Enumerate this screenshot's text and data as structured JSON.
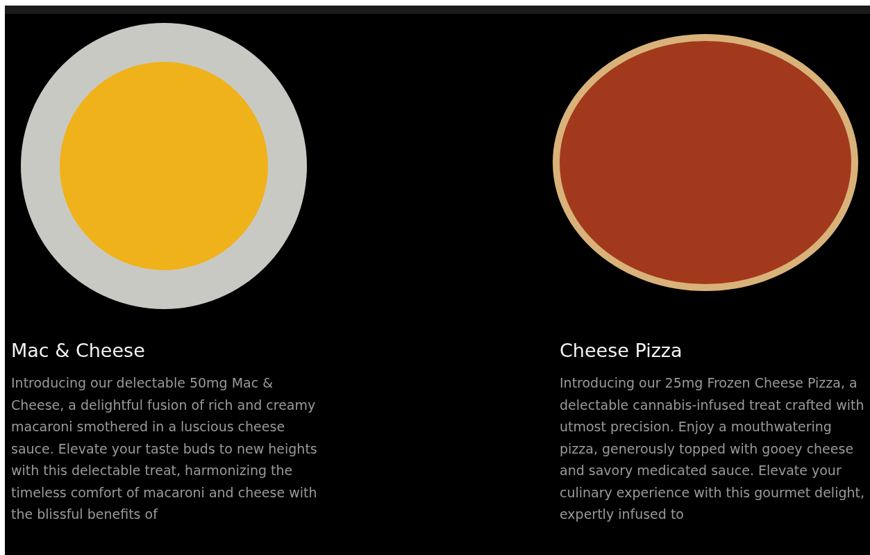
{
  "products": [
    {
      "kind": "bowl",
      "name": "Mac & Cheese",
      "description": "Introducing our delectable 50mg Mac & Cheese, a delightful fusion of rich and creamy macaroni smothered in a luscious cheese sauce. Elevate your taste buds to new heights with this delectable treat, harmonizing the timeless comfort of macaroni and cheese with the blissful benefits of"
    },
    {
      "kind": "pizza",
      "name": "Cheese Pizza",
      "description": "Introducing our 25mg Frozen Cheese Pizza, a delectable cannabis-infused treat crafted with utmost precision. Enjoy a mouthwatering pizza, generously topped with gooey cheese and savory medicated sauce. Elevate your culinary experience with this gourmet delight, expertly infused to"
    }
  ]
}
